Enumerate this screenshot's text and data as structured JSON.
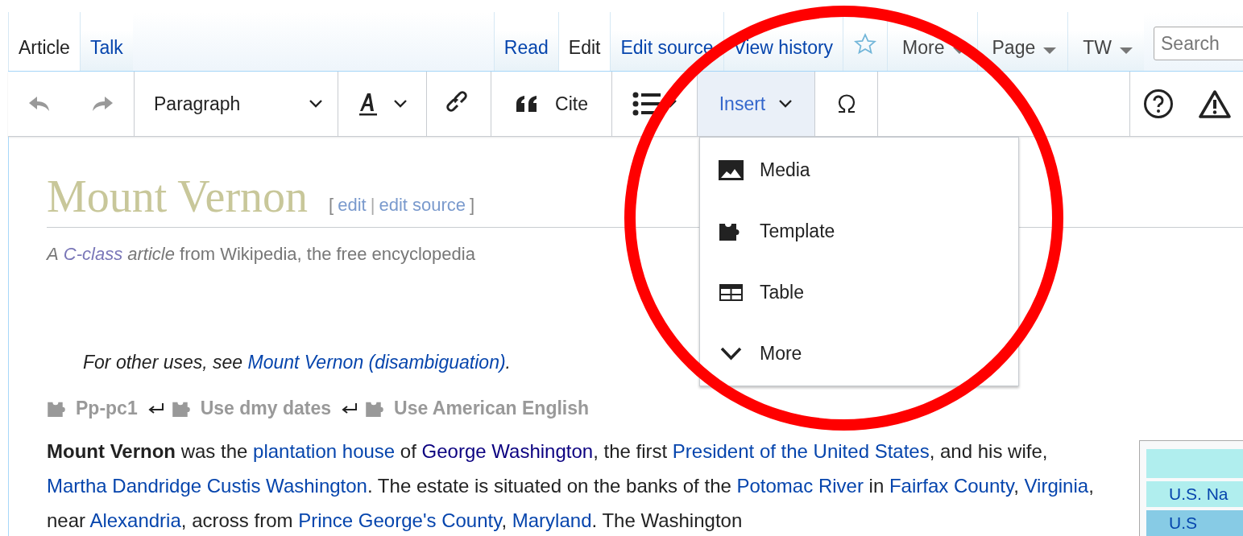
{
  "left_tabs": [
    {
      "label": "Article",
      "selected": true
    },
    {
      "label": "Talk",
      "selected": false
    }
  ],
  "right_tabs": [
    {
      "label": "Read",
      "selected": false
    },
    {
      "label": "Edit",
      "selected": true
    },
    {
      "label": "Edit source",
      "selected": false
    },
    {
      "label": "View history",
      "selected": false
    }
  ],
  "menus": [
    {
      "label": "More"
    },
    {
      "label": "Page"
    },
    {
      "label": "TW"
    }
  ],
  "search": {
    "placeholder": "Search"
  },
  "toolbar": {
    "format": "Paragraph",
    "cite": "Cite",
    "insert": {
      "label": "Insert",
      "expanded": true
    }
  },
  "insert_menu": [
    {
      "kind": "media",
      "label": "Media"
    },
    {
      "kind": "template",
      "label": "Template"
    },
    {
      "kind": "table",
      "label": "Table"
    },
    {
      "kind": "more",
      "label": "More"
    }
  ],
  "title": "Mount Vernon",
  "edit_links": [
    "edit",
    "edit source"
  ],
  "edit_brackets": {
    "open": "[",
    "separator": "|",
    "close": "]"
  },
  "tagline": {
    "prefix": "A",
    "class_link": "C-class",
    "suffix": "article",
    "rest": "from Wikipedia, the free encyclopedia"
  },
  "hatnote": {
    "text": "For other uses, see",
    "link": "Mount Vernon (disambiguation)",
    "end": "."
  },
  "templates": [
    "Pp-pc1",
    "Use dmy dates",
    "Use American English"
  ],
  "paragraph": [
    {
      "kind": "bold",
      "text": "Mount Vernon"
    },
    {
      "kind": "text",
      "text": " was the "
    },
    {
      "kind": "link",
      "text": "plantation house"
    },
    {
      "kind": "text",
      "text": " of "
    },
    {
      "kind": "visited",
      "text": "George Washington"
    },
    {
      "kind": "text",
      "text": ", the first "
    },
    {
      "kind": "link",
      "text": "President of the United States"
    },
    {
      "kind": "text",
      "text": ", and his wife, "
    },
    {
      "kind": "link",
      "text": "Martha Dandridge Custis Washington"
    },
    {
      "kind": "text",
      "text": ". The estate is situated on the banks of the "
    },
    {
      "kind": "link",
      "text": "Potomac River"
    },
    {
      "kind": "text",
      "text": " in "
    },
    {
      "kind": "link",
      "text": "Fairfax County"
    },
    {
      "kind": "text",
      "text": ", "
    },
    {
      "kind": "link",
      "text": "Virginia"
    },
    {
      "kind": "text",
      "text": ", near "
    },
    {
      "kind": "link",
      "text": "Alexandria"
    },
    {
      "kind": "text",
      "text": ", across from "
    },
    {
      "kind": "link",
      "text": "Prince George's County"
    },
    {
      "kind": "text",
      "text": ", "
    },
    {
      "kind": "link",
      "text": "Maryland"
    },
    {
      "kind": "text",
      "text": ". The Washington"
    }
  ],
  "infobox": [
    "U.S. Na",
    "U.S"
  ],
  "annotation": {
    "kind": "circle"
  }
}
